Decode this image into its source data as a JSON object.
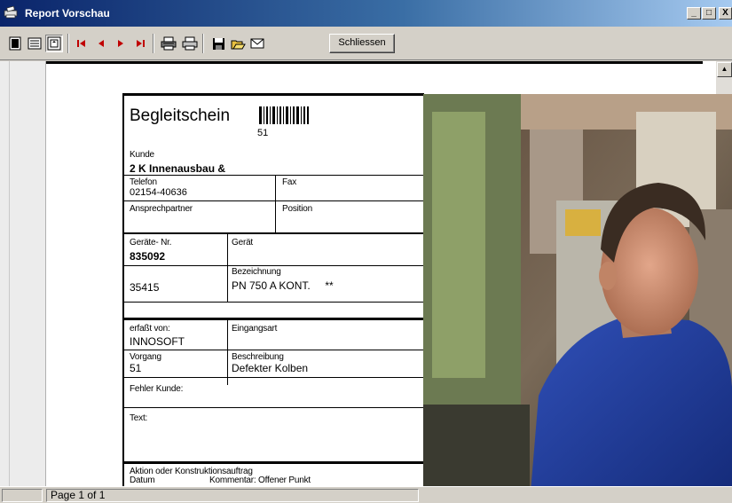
{
  "window": {
    "title": "Report Vorschau",
    "min": "_",
    "max": "□",
    "close": "X"
  },
  "toolbar": {
    "buttons": [
      "single-page",
      "two-pages",
      "page-width",
      "first-page",
      "previous-page",
      "next-page",
      "last-page",
      "print-setup",
      "print",
      "save",
      "open",
      "email"
    ],
    "close_label": "Schliessen"
  },
  "report": {
    "title": "Begleitschein",
    "barcode_number": "51",
    "kunde_label": "Kunde",
    "kunde_value": "2 K Innenausbau &",
    "telefon_label": "Telefon",
    "telefon_value": "02154-40636",
    "fax_label": "Fax",
    "ansprechpartner_label": "Ansprechpartner",
    "position_label": "Position",
    "geraete_nr_label": "Geräte- Nr.",
    "geraete_nr_value": "835092",
    "geraet_label": "Gerät",
    "bezeichnung_label": "Bezeichnung",
    "geraet_code": "35415",
    "bezeichnung_value": "PN 750 A KONT.     **",
    "erfasst_label": "erfaßt von:",
    "erfasst_value": "INNOSOFT",
    "eingangsart_label": "Eingangsart",
    "vorgang_label": "Vorgang",
    "vorgang_value": "51",
    "beschreibung_label": "Beschreibung",
    "beschreibung_value": "Defekter Kolben",
    "fehler_label": "Fehler Kunde:",
    "text_label": "Text:",
    "aktion_label": "Aktion oder Konstruktionsauftrag",
    "datum_label": "Datum",
    "kommentar_label": "Kommentar: Offener Punkt"
  },
  "status": {
    "page_text": "Page 1 of 1"
  },
  "colors": {
    "titlebar_start": "#0a246a",
    "titlebar_end": "#a6caf0",
    "chrome": "#d4d0c8"
  }
}
